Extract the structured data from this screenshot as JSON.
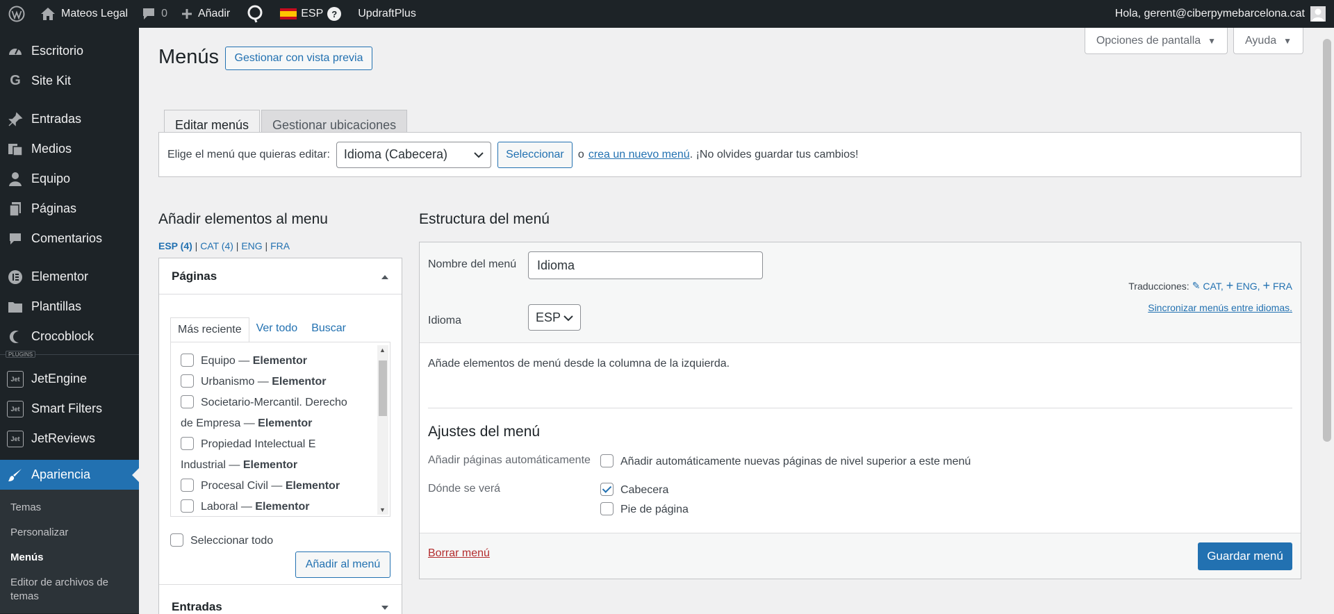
{
  "adminbar": {
    "site_name": "Mateos Legal",
    "comments_count": "0",
    "new_label": "Añadir",
    "lang_label": "ESP",
    "lang_help": "?",
    "updraft_label": "UpdraftPlus",
    "greeting": "Hola, gerent@ciberpymebarcelona.cat"
  },
  "sidebar": {
    "items": [
      {
        "label": "Escritorio",
        "icon": "dashboard-icon"
      },
      {
        "label": "Site Kit",
        "icon": "google-icon"
      },
      {
        "label": "Entradas",
        "icon": "pin-icon"
      },
      {
        "label": "Medios",
        "icon": "media-icon"
      },
      {
        "label": "Equipo",
        "icon": "user-icon"
      },
      {
        "label": "Páginas",
        "icon": "pages-icon"
      },
      {
        "label": "Comentarios",
        "icon": "comment-icon"
      },
      {
        "label": "Elementor",
        "icon": "elementor-icon"
      },
      {
        "label": "Plantillas",
        "icon": "folder-icon"
      },
      {
        "label": "Crocoblock",
        "icon": "crocoblock-icon"
      },
      {
        "label": "JetEngine",
        "icon": "jet-icon"
      },
      {
        "label": "Smart Filters",
        "icon": "jet-icon"
      },
      {
        "label": "JetReviews",
        "icon": "jet-icon"
      },
      {
        "label": "Apariencia",
        "icon": "brush-icon"
      }
    ],
    "plugins_label": "PLUGINS",
    "submenu": [
      "Temas",
      "Personalizar",
      "Menús",
      "Editor de archivos de temas"
    ]
  },
  "screen_options": "Opciones de pantalla",
  "help": "Ayuda",
  "page": {
    "title": "Menús",
    "preview_button": "Gestionar con vista previa",
    "tab_edit": "Editar menús",
    "tab_locations": "Gestionar ubicaciones"
  },
  "manage": {
    "label": "Elige el menú que quieras editar:",
    "selected": "Idioma (Cabecera)",
    "select_button": "Seleccionar",
    "or": "o",
    "create_link": "crea un nuevo menú",
    "reminder": ". ¡No olvides guardar tus cambios!"
  },
  "add_items": {
    "title": "Añadir elementos al menu",
    "langs": [
      {
        "label": "ESP (4)",
        "active": true
      },
      {
        "label": "CAT (4)"
      },
      {
        "label": "ENG"
      },
      {
        "label": "FRA"
      }
    ],
    "pages_title": "Páginas",
    "tabs": [
      "Más reciente",
      "Ver todo",
      "Buscar"
    ],
    "pages": [
      {
        "line1": "Equipo — ",
        "bold": "Elementor"
      },
      {
        "line1": "Urbanismo — ",
        "bold": "Elementor"
      },
      {
        "line1": "Societario-Mercantil. Derecho",
        "line2": "de Empresa — ",
        "bold": "Elementor"
      },
      {
        "line1": "Propiedad Intelectual E",
        "line2": "Industrial — ",
        "bold": "Elementor"
      },
      {
        "line1": "Procesal Civil — ",
        "bold": "Elementor"
      },
      {
        "line1": "Laboral — ",
        "bold": "Elementor"
      }
    ],
    "select_all": "Seleccionar todo",
    "add_button": "Añadir al menú",
    "posts_title": "Entradas"
  },
  "structure": {
    "title": "Estructura del menú",
    "name_label": "Nombre del menú",
    "name_value": "Idioma",
    "translations_label": "Traducciones:",
    "translations": [
      "CAT,",
      "ENG,",
      "FRA"
    ],
    "sync_link": "Sincronizar menús entre idiomas.",
    "language_label": "Idioma",
    "language_value": "ESP",
    "empty_hint": "Añade elementos de menú desde la columna de la izquierda.",
    "settings_title": "Ajustes del menú",
    "auto_add_label": "Añadir páginas automáticamente",
    "auto_add_option": "Añadir automáticamente nuevas páginas de nivel superior a este menú",
    "display_label": "Dónde se verá",
    "location_header": "Cabecera",
    "location_footer": "Pie de página",
    "delete_link": "Borrar menú",
    "save_button": "Guardar menú"
  }
}
